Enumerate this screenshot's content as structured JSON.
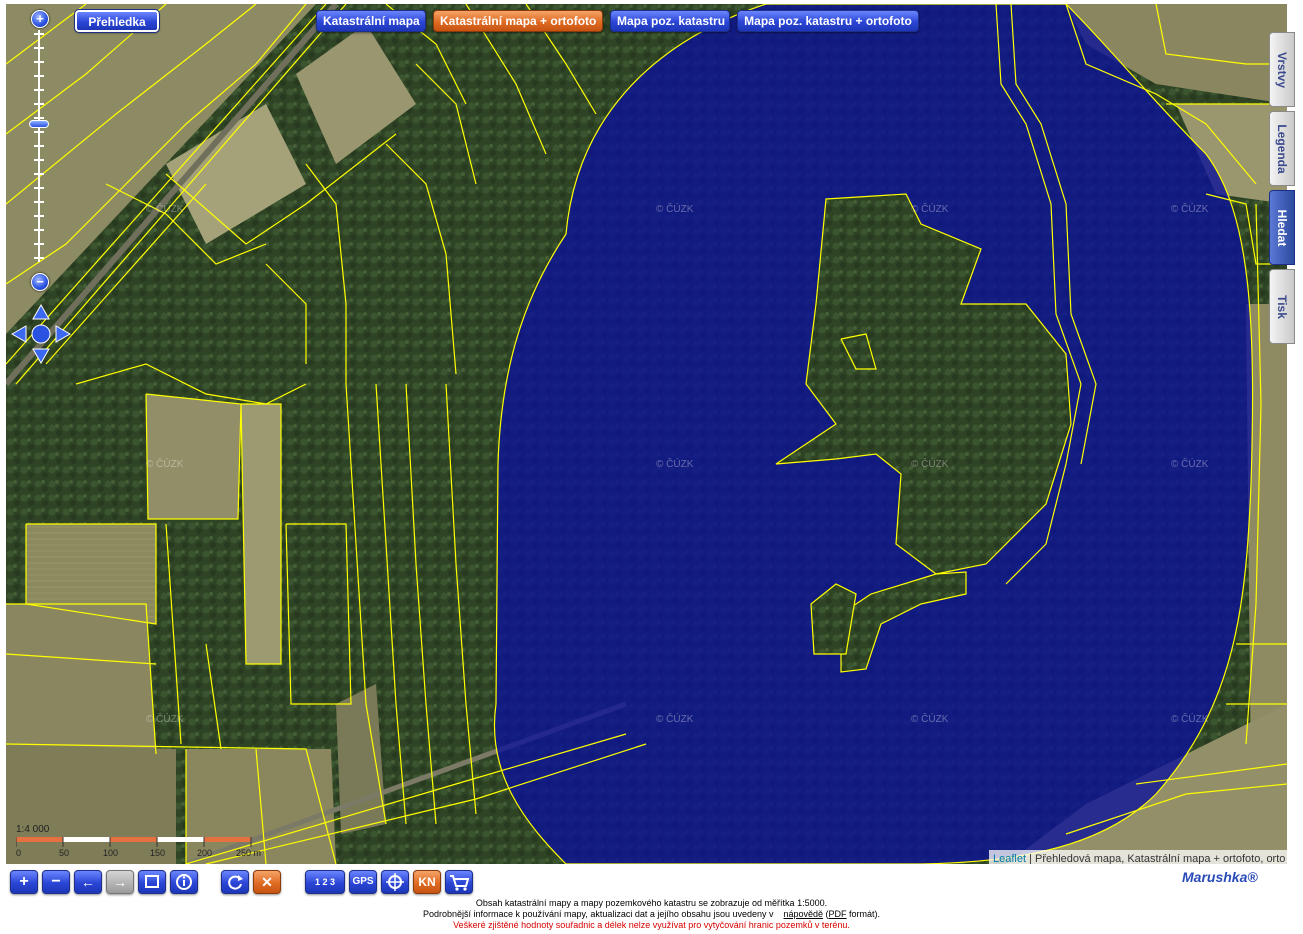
{
  "map": {
    "overview_label": "Přehledka",
    "layers": [
      {
        "label": "Katastrální mapa",
        "active": false
      },
      {
        "label": "Katastrální mapa + ortofoto",
        "active": true
      },
      {
        "label": "Mapa poz. katastru",
        "active": false
      },
      {
        "label": "Mapa poz. katastru + ortofoto",
        "active": false
      }
    ],
    "side_tabs": [
      {
        "label": "Vrstvy",
        "active": false
      },
      {
        "label": "Legenda",
        "active": false
      },
      {
        "label": "Hledat",
        "active": true
      },
      {
        "label": "Tisk",
        "active": false
      }
    ],
    "zoom": {
      "plus": "+",
      "minus": "−",
      "level_fraction": 0.4
    },
    "watermark": "© ČÚZK",
    "scale": {
      "ratio": "1:4 000",
      "ticks": [
        "0",
        "50",
        "100",
        "150",
        "200",
        "250 m"
      ]
    },
    "attribution": {
      "leaflet": "Leaflet",
      "text": " | Přehledová mapa, Katastrální mapa + ortofoto, orto"
    },
    "colors": {
      "parcel_lines": "#ffff00",
      "highlight": "#0a0f9a",
      "active_btn": "#e06b22",
      "btn": "#2b46d6"
    }
  },
  "toolbar": {
    "zoom_in": "+",
    "zoom_out": "−",
    "back": "←",
    "forward": "→",
    "zoom_box_icon": "zoom-box-icon",
    "info_icon": "info-icon",
    "refresh_icon": "refresh-icon",
    "clear": "✕",
    "measure": "1 2 3",
    "gps": "GPS",
    "locate_icon": "crosshair-icon",
    "kn": "KN",
    "cart_icon": "cart-icon"
  },
  "brand": "Marushka®",
  "footer": {
    "line1": "Obsah katastrální mapy a mapy pozemkového katastru se zobrazuje od měřítka 1:5000.",
    "line2_pre": "Podrobnější informace k používání mapy, aktualizaci dat a jejího obsahu jsou uvedeny v",
    "line2_link1": "nápovědě",
    "line2_mid": " (",
    "line2_link2": "PDF",
    "line2_post": " formát).",
    "warning": "Veškeré zjištěné hodnoty souřadnic a délek nelze využívat pro vytyčování hranic pozemků v terénu."
  }
}
